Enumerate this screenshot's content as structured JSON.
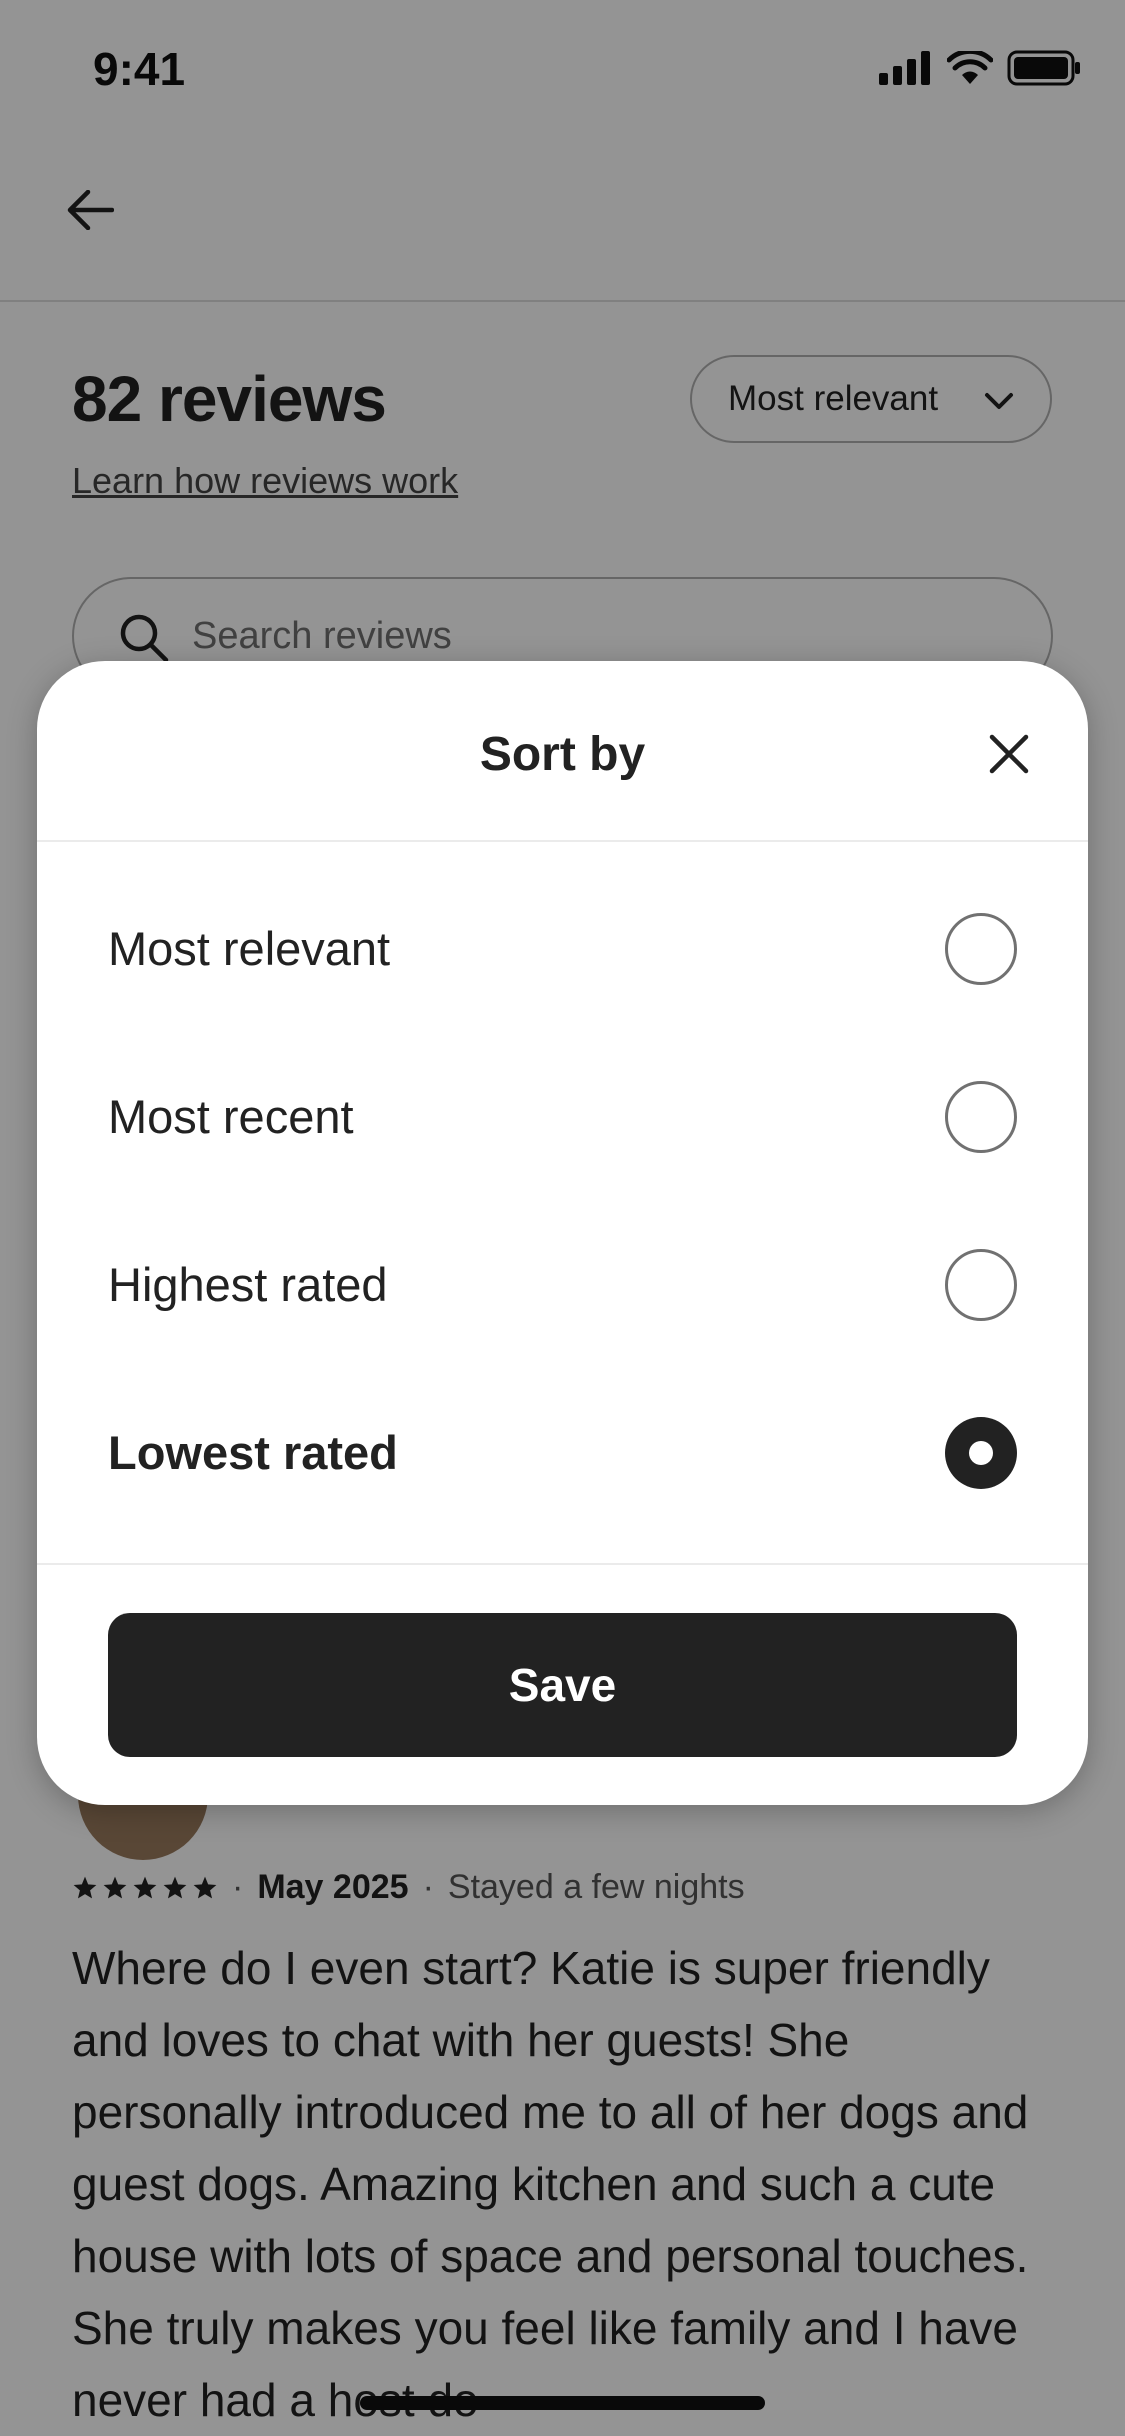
{
  "status_bar": {
    "time": "9:41"
  },
  "header": {
    "back_icon": "arrow-left-icon"
  },
  "reviews": {
    "title": "82 reviews",
    "learn_link": "Learn how reviews work",
    "sort_pill_label": "Most relevant",
    "search_placeholder": "Search reviews"
  },
  "review": {
    "rating": 5,
    "date": "May 2025",
    "stay": "Stayed a few nights",
    "text": "Where do I even start? Katie is super friendly and loves to chat with her guests! She personally introduced me to all of her dogs and guest dogs. Amazing kitchen and such a cute house with lots of space and personal touches. She truly makes you feel like family and I have never had a host do"
  },
  "sheet": {
    "title": "Sort by",
    "options": [
      {
        "label": "Most relevant",
        "selected": false
      },
      {
        "label": "Most recent",
        "selected": false
      },
      {
        "label": "Highest rated",
        "selected": false
      },
      {
        "label": "Lowest rated",
        "selected": true
      }
    ],
    "save_label": "Save"
  },
  "colors": {
    "primary": "#222222",
    "overlay": "rgba(0,0,0,0.42)",
    "border": "#b0b0b0"
  }
}
